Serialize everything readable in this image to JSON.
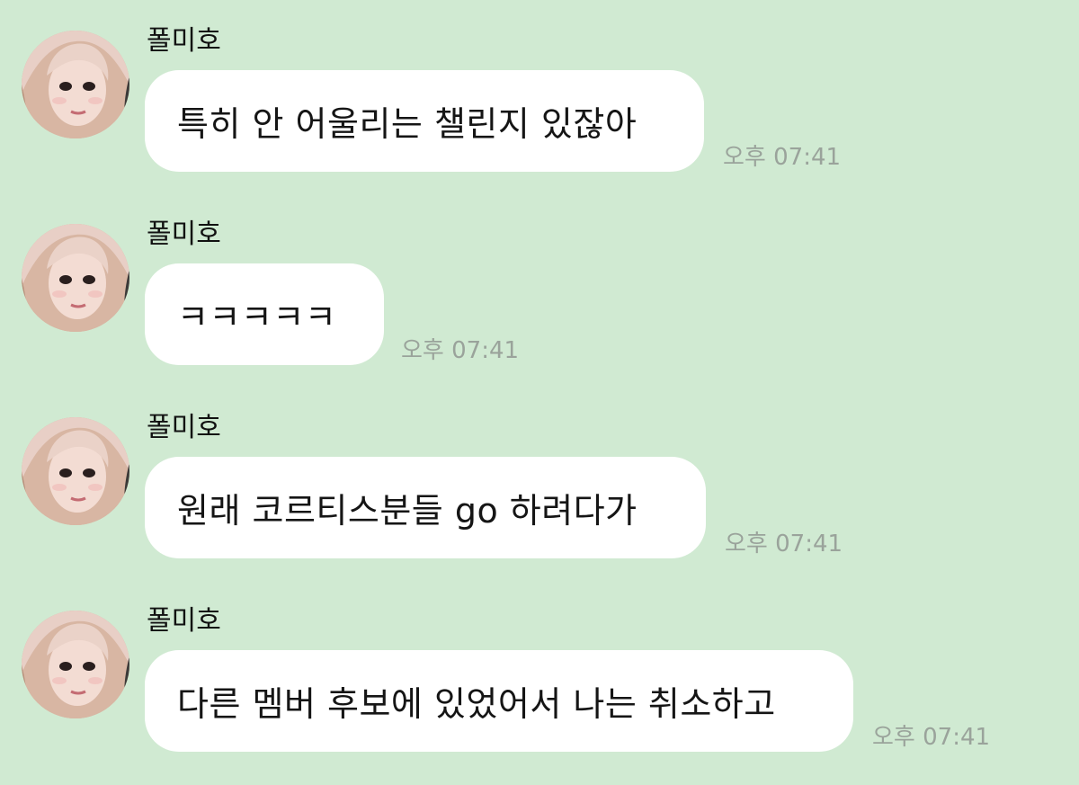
{
  "messages": [
    {
      "sender": "폴미호",
      "text": "특히 안 어울리는 챌린지 있잖아",
      "time": "오후 07:41"
    },
    {
      "sender": "폴미호",
      "text": "ㅋㅋㅋㅋㅋ",
      "time": "오후 07:41"
    },
    {
      "sender": "폴미호",
      "text": "원래 코르티스분들 go 하려다가",
      "time": "오후 07:41"
    },
    {
      "sender": "폴미호",
      "text": "다른 멤버 후보에 있었어서 나는 취소하고",
      "time": "오후 07:41"
    }
  ],
  "colors": {
    "background": "#d0ead2",
    "bubble": "#ffffff",
    "timestamp": "#9aa39b"
  }
}
